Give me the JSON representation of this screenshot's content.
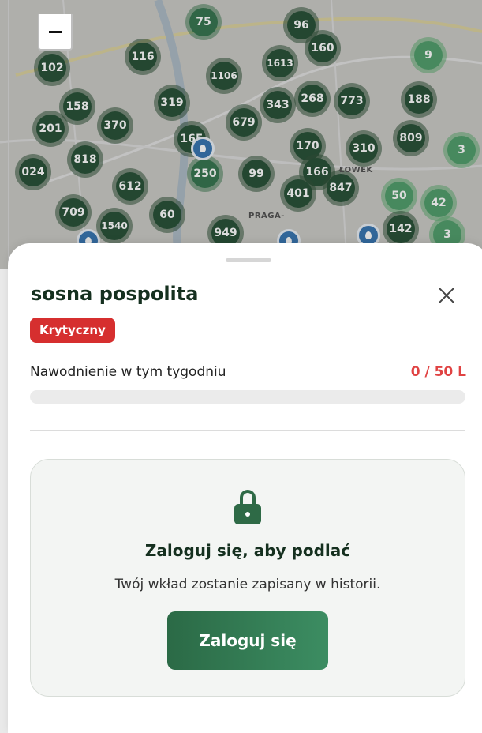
{
  "map": {
    "clusters": [
      {
        "label": "75",
        "tone": "mid"
      },
      {
        "label": "96",
        "tone": "dark"
      },
      {
        "label": "160",
        "tone": "dark"
      },
      {
        "label": "9",
        "tone": "light"
      },
      {
        "label": "102",
        "tone": "dark"
      },
      {
        "label": "116",
        "tone": "dark"
      },
      {
        "label": "1106",
        "tone": "dark"
      },
      {
        "label": "1613",
        "tone": "dark"
      },
      {
        "label": "158",
        "tone": "dark"
      },
      {
        "label": "319",
        "tone": "dark"
      },
      {
        "label": "268",
        "tone": "dark"
      },
      {
        "label": "773",
        "tone": "dark"
      },
      {
        "label": "188",
        "tone": "dark"
      },
      {
        "label": "343",
        "tone": "dark"
      },
      {
        "label": "679",
        "tone": "dark"
      },
      {
        "label": "201",
        "tone": "dark"
      },
      {
        "label": "370",
        "tone": "dark"
      },
      {
        "label": "165",
        "tone": "dark"
      },
      {
        "label": "170",
        "tone": "dark"
      },
      {
        "label": "310",
        "tone": "dark"
      },
      {
        "label": "809",
        "tone": "dark"
      },
      {
        "label": "3",
        "tone": "light"
      },
      {
        "label": "818",
        "tone": "dark"
      },
      {
        "label": "024",
        "tone": "dark"
      },
      {
        "label": "166",
        "tone": "dark"
      },
      {
        "label": "612",
        "tone": "dark"
      },
      {
        "label": "250",
        "tone": "mid"
      },
      {
        "label": "99",
        "tone": "dark"
      },
      {
        "label": "401",
        "tone": "dark"
      },
      {
        "label": "847",
        "tone": "dark"
      },
      {
        "label": "50",
        "tone": "light"
      },
      {
        "label": "42",
        "tone": "light"
      },
      {
        "label": "709",
        "tone": "dark"
      },
      {
        "label": "60",
        "tone": "dark"
      },
      {
        "label": "1540",
        "tone": "dark"
      },
      {
        "label": "949",
        "tone": "dark"
      },
      {
        "label": "142",
        "tone": "dark"
      },
      {
        "label": "3",
        "tone": "light"
      }
    ],
    "labels": [
      "PRAGA-",
      "ŁOWEK"
    ],
    "zoom_out_icon": "minus-icon"
  },
  "sheet": {
    "title": "sosna pospolita",
    "close_icon": "close-icon",
    "status_badge": "Krytyczny",
    "status_color": "#d62f2f",
    "watering_label": "Nawodnienie w tym tygodniu",
    "watering_value": "0 / 50 L",
    "watering_progress": 0,
    "login_card": {
      "icon": "lock-icon",
      "title": "Zaloguj się, aby podlać",
      "subtitle": "Twój wkład zostanie zapisany w historii.",
      "button_label": "Zaloguj się"
    }
  },
  "colors": {
    "primary_green": "#2e6a46",
    "critical_red": "#e04343"
  }
}
